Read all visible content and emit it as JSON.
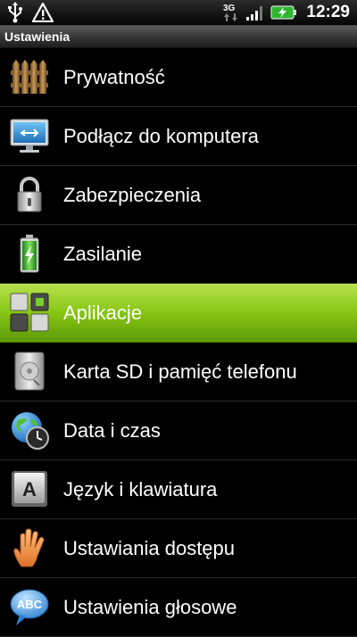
{
  "status_bar": {
    "icons": [
      "usb-icon",
      "warning-icon",
      "3g-icon",
      "signal-icon",
      "battery-charging-icon"
    ],
    "network": "3G",
    "time": "12:29"
  },
  "title": "Ustawienia",
  "menu": {
    "items": [
      {
        "label": "Prywatność",
        "icon": "privacy-fence-icon"
      },
      {
        "label": "Podłącz do komputera",
        "icon": "computer-monitor-icon"
      },
      {
        "label": "Zabezpieczenia",
        "icon": "padlock-icon"
      },
      {
        "label": "Zasilanie",
        "icon": "battery-icon"
      },
      {
        "label": "Aplikacje",
        "icon": "applications-grid-icon"
      },
      {
        "label": "Karta SD i pamięć telefonu",
        "icon": "sd-card-icon"
      },
      {
        "label": "Data i czas",
        "icon": "globe-clock-icon"
      },
      {
        "label": "Język i klawiatura",
        "icon": "keyboard-key-icon"
      },
      {
        "label": "Ustawiania dostępu",
        "icon": "hand-icon"
      },
      {
        "label": "Ustawienia głosowe",
        "icon": "speech-bubble-icon"
      }
    ],
    "selected_index": 4
  },
  "colors": {
    "selection": "#86c614",
    "background": "#000000"
  }
}
